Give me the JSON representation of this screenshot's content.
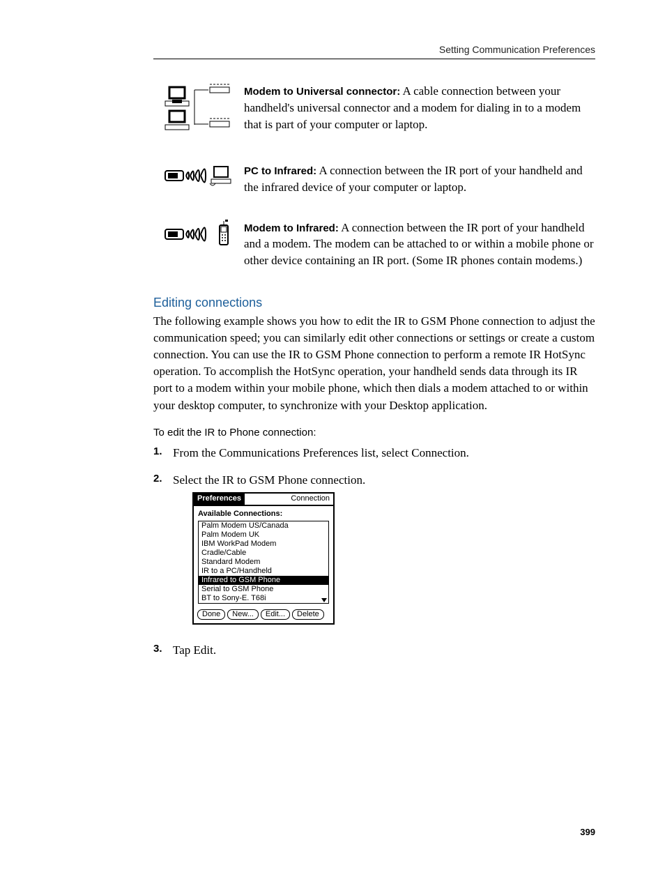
{
  "header": {
    "title": "Setting Communication Preferences"
  },
  "blocks": [
    {
      "label": "Modem to Universal connector:",
      "text": " A cable connection between your handheld's universal connector and a modem for dialing in to a modem that is part of your computer or laptop."
    },
    {
      "label": "PC to Infrared:",
      "text": " A connection between the IR port of your handheld and the infrared device of your computer or laptop."
    },
    {
      "label": "Modem to Infrared:",
      "text": " A connection between the IR port of your handheld and a modem. The modem can be attached to or within a mobile phone or other device containing an IR port. (Some IR phones contain modems.)"
    }
  ],
  "editing": {
    "heading": "Editing connections",
    "para": "The following example shows you how to edit the IR to GSM Phone connection to adjust the communication speed; you can similarly edit other connections or settings or create a custom connection. You can use the IR to GSM Phone connection to perform a remote IR HotSync operation. To accomplish the HotSync operation, your handheld sends data through its IR port to a modem within your mobile phone, which then dials a modem attached to or within your desktop computer, to synchronize with your Desktop application.",
    "subhead": "To edit the IR to Phone connection:",
    "steps": [
      "From the Communications Preferences list, select Connection.",
      "Select the IR to GSM Phone connection.",
      "Tap Edit."
    ]
  },
  "palm": {
    "title": "Preferences",
    "category": "Connection",
    "subhead": "Available Connections:",
    "items": [
      "Palm Modem US/Canada",
      "Palm Modem UK",
      "IBM WorkPad Modem",
      "Cradle/Cable",
      "Standard Modem",
      "IR to a PC/Handheld",
      "Infrared to GSM Phone",
      "Serial to GSM Phone",
      "BT to Sony-E. T68i"
    ],
    "selected_index": 6,
    "buttons": [
      "Done",
      "New...",
      "Edit...",
      "Delete"
    ]
  },
  "page_number": "399"
}
